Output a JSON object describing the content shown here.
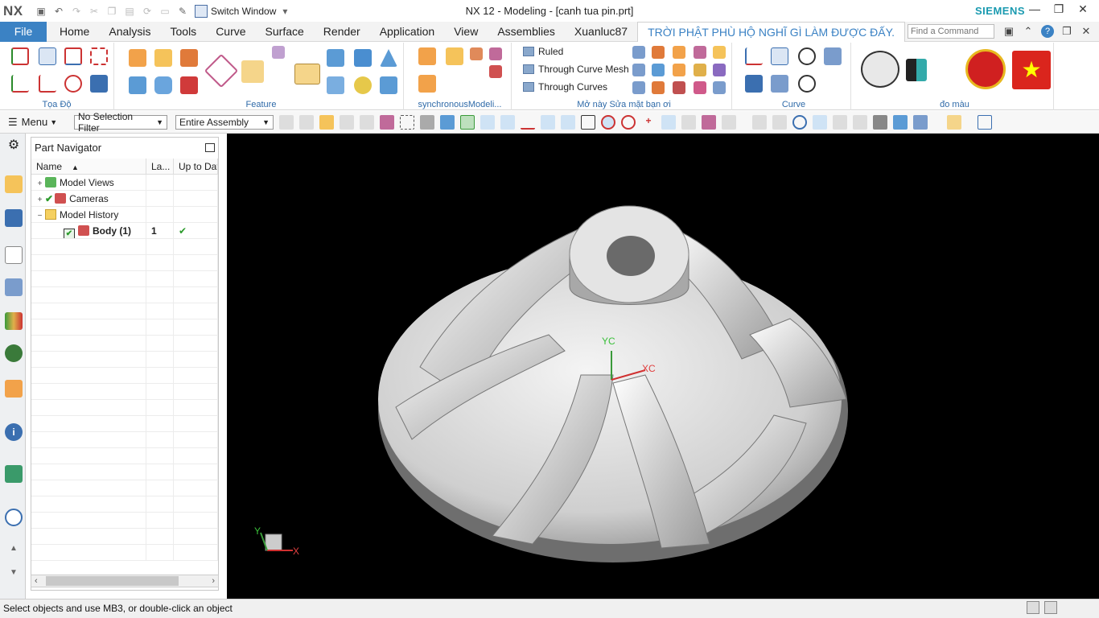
{
  "app": {
    "logo": "NX",
    "title": "NX 12 - Modeling - [canh tua pin.prt]",
    "brand": "SIEMENS",
    "switch_window": "Switch Window",
    "find_placeholder": "Find a Command"
  },
  "menubar": {
    "file": "File",
    "tabs": [
      "Home",
      "Analysis",
      "Tools",
      "Curve",
      "Surface",
      "Render",
      "Application",
      "View",
      "Assemblies",
      "Xuanluc87",
      "TRỜI PHẬT PHÙ HỘ NGHĨ GÌ LÀM ĐƯỢC ĐẤY."
    ]
  },
  "ribbon": {
    "groups": [
      "Tọa Độ",
      "Feature",
      "synchronousModeli...",
      "Mở này Sửa mặt bạn ơi",
      "Curve",
      "đo màu"
    ],
    "surface_items": [
      "Ruled",
      "Through Curve Mesh",
      "Through Curves"
    ]
  },
  "toolbar": {
    "menu": "Menu",
    "selection_filter": "No Selection Filter",
    "scope": "Entire Assembly"
  },
  "navigator": {
    "title": "Part Navigator",
    "columns": [
      "Name",
      "La...",
      "Up to Dat"
    ],
    "rows": [
      {
        "name": "Model Views",
        "layer": "",
        "uptodate": "",
        "expander": "+"
      },
      {
        "name": "Cameras",
        "layer": "",
        "uptodate": "",
        "expander": "+"
      },
      {
        "name": "Model History",
        "layer": "",
        "uptodate": "",
        "expander": "−"
      },
      {
        "name": "Body (1)",
        "layer": "1",
        "uptodate": "✔",
        "expander": ""
      }
    ]
  },
  "viewport": {
    "wcs_y": "YC",
    "wcs_x": "XC",
    "triad_y": "Y",
    "triad_x": "X"
  },
  "status": {
    "text": "Select objects and use MB3, or double-click an object"
  },
  "colors": {
    "accent": "#3b82c4",
    "ribbon_label": "#2f6aa8",
    "viewport_bg": "#000000"
  }
}
